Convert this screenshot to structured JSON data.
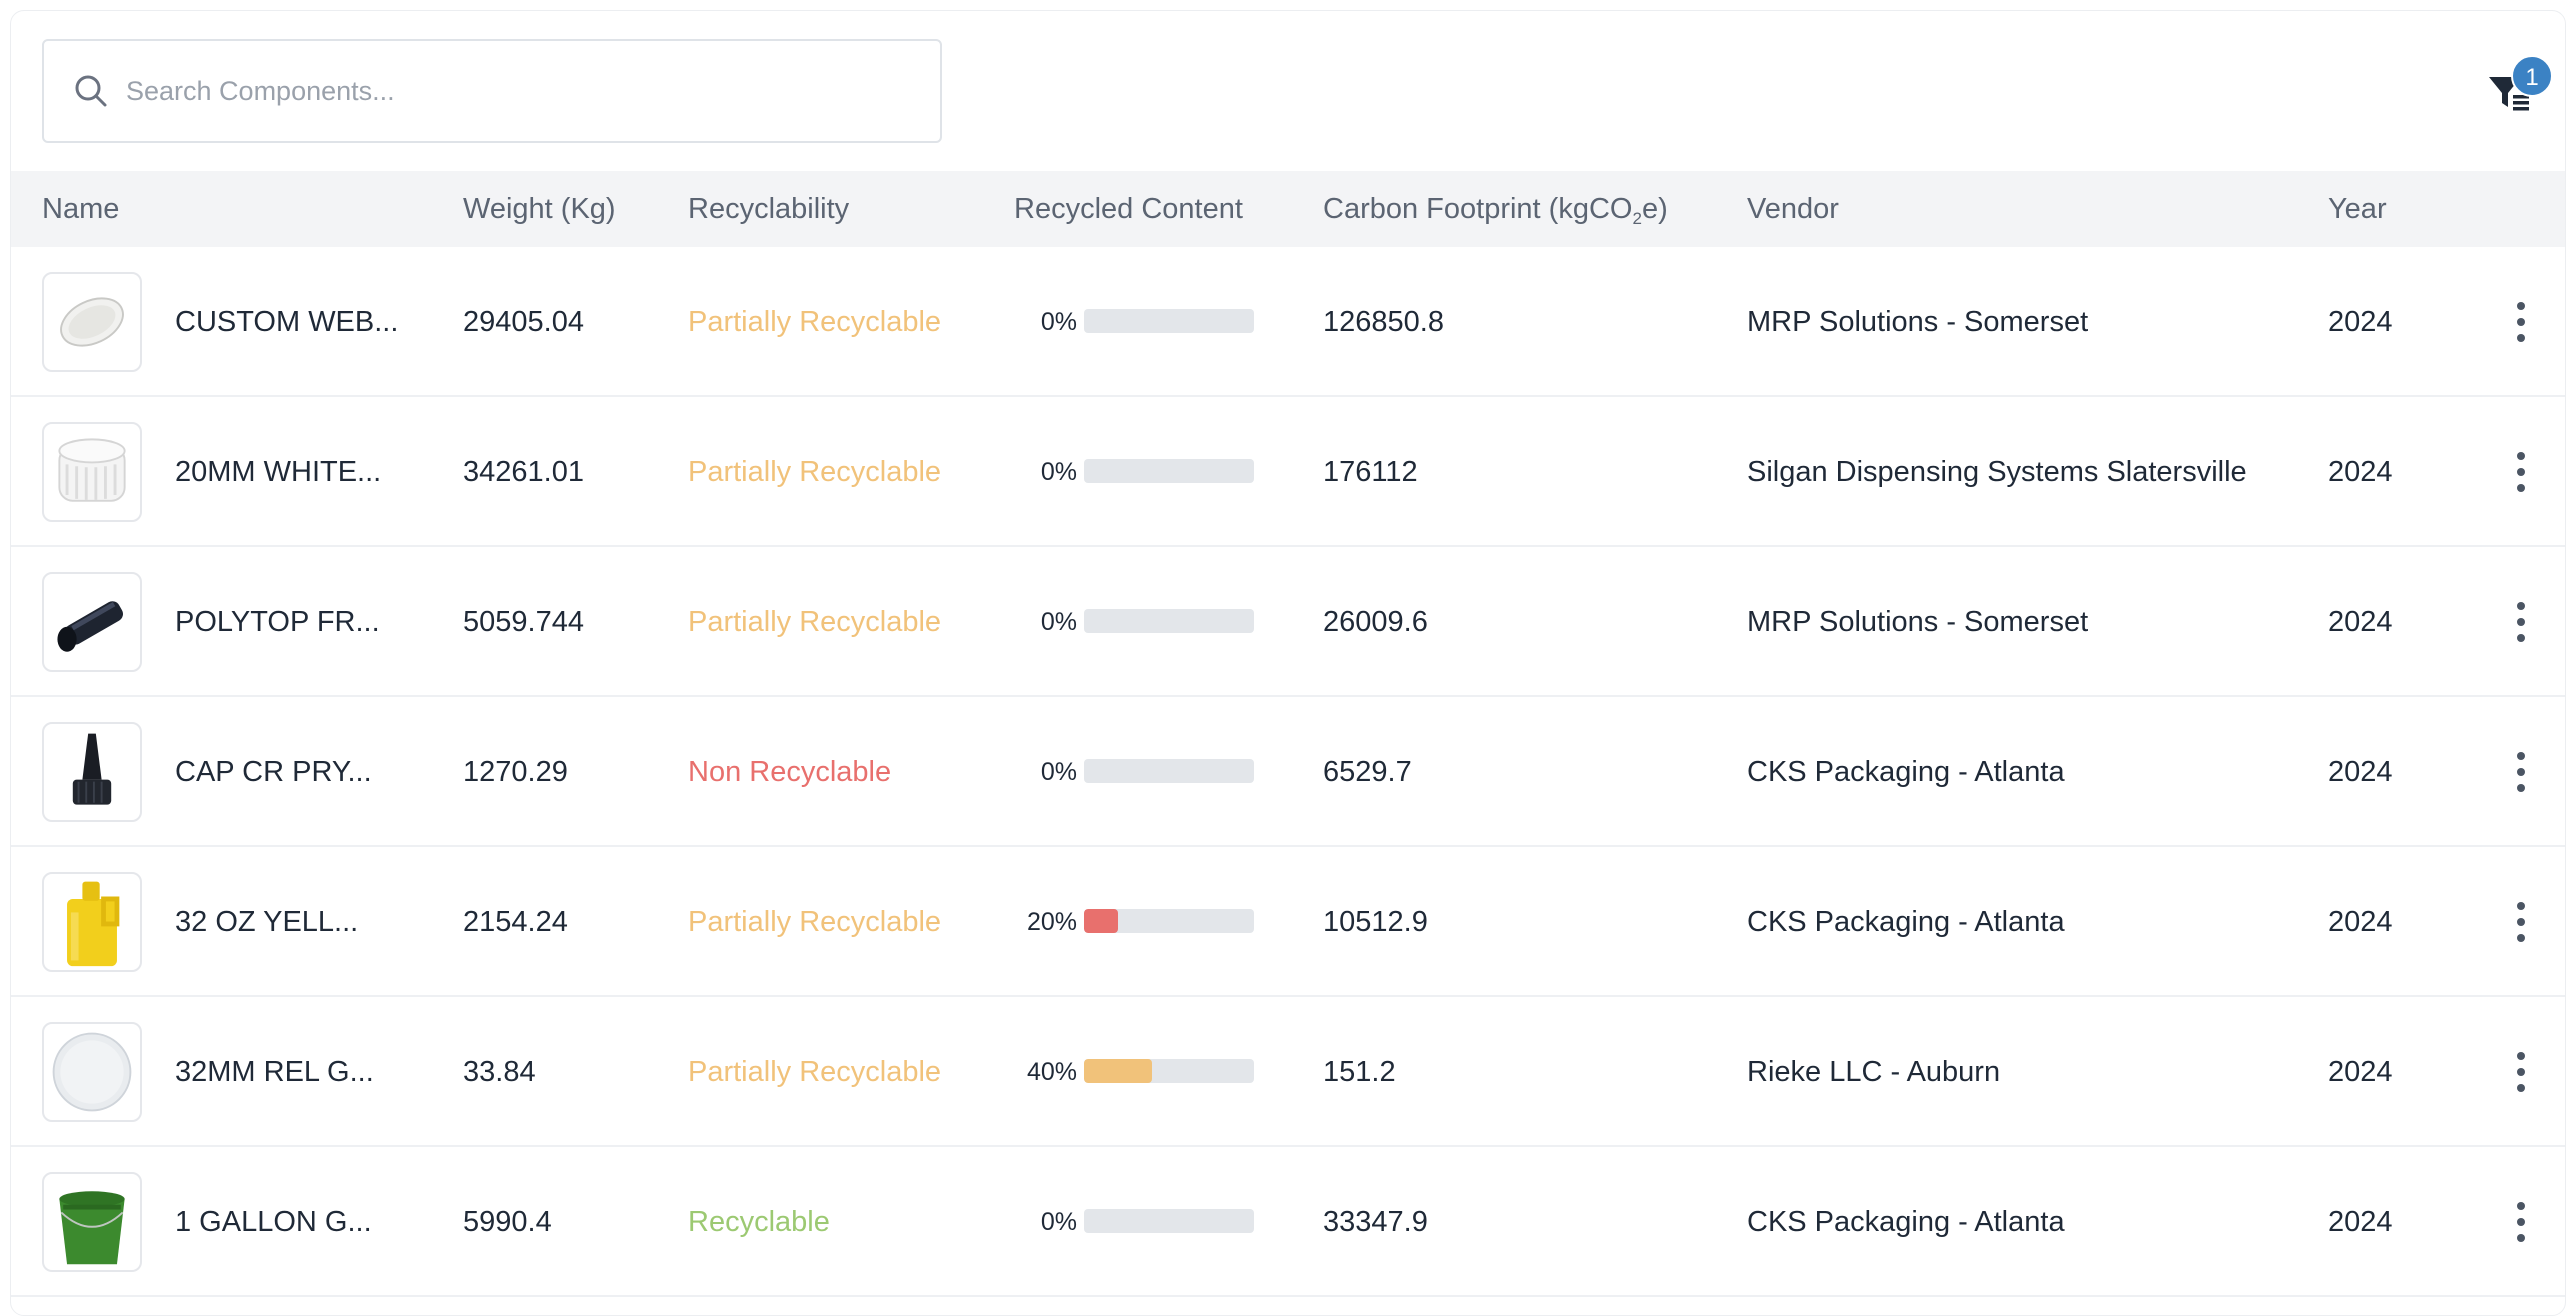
{
  "search": {
    "placeholder": "Search Components..."
  },
  "filter": {
    "badge_count": "1"
  },
  "columns": {
    "name": "Name",
    "weight": "Weight (Kg)",
    "recyclability": "Recyclability",
    "recycled_content": "Recycled Content",
    "carbon_prefix": "Carbon Footprint (kgCO",
    "carbon_sub": "2",
    "carbon_suffix": "e)",
    "vendor": "Vendor",
    "year": "Year"
  },
  "colors": {
    "partial": "#f1c27a",
    "non": "#e8706d",
    "recyclable": "#9cc972",
    "bar_track": "#e3e6ea",
    "badge": "#3b82c4"
  },
  "rows": [
    {
      "thumb_icon": "white-oval-lid-icon",
      "name": "CUSTOM WEB...",
      "weight": "29405.04",
      "recyclability": "Partially Recyclable",
      "rec_class": "partial",
      "pct_label": "0%",
      "pct": 0,
      "bar_color": "#e3e6ea",
      "carbon": "126850.8",
      "vendor": "MRP Solutions - Somerset",
      "year": "2024"
    },
    {
      "thumb_icon": "white-ribbed-cap-icon",
      "name": "20MM WHITE...",
      "weight": "34261.01",
      "recyclability": "Partially Recyclable",
      "rec_class": "partial",
      "pct_label": "0%",
      "pct": 0,
      "bar_color": "#e3e6ea",
      "carbon": "176112",
      "vendor": "Silgan Dispensing Systems Slatersville",
      "year": "2024"
    },
    {
      "thumb_icon": "black-tube-icon",
      "name": "POLYTOP FR...",
      "weight": "5059.744",
      "recyclability": "Partially Recyclable",
      "rec_class": "partial",
      "pct_label": "0%",
      "pct": 0,
      "bar_color": "#e3e6ea",
      "carbon": "26009.6",
      "vendor": "MRP Solutions - Somerset",
      "year": "2024"
    },
    {
      "thumb_icon": "black-spout-cap-icon",
      "name": "CAP CR PRY...",
      "weight": "1270.29",
      "recyclability": "Non Recyclable",
      "rec_class": "non",
      "pct_label": "0%",
      "pct": 0,
      "bar_color": "#e3e6ea",
      "carbon": "6529.7",
      "vendor": "CKS Packaging - Atlanta",
      "year": "2024"
    },
    {
      "thumb_icon": "yellow-jug-icon",
      "name": "32 OZ YELL...",
      "weight": "2154.24",
      "recyclability": "Partially Recyclable",
      "rec_class": "partial",
      "pct_label": "20%",
      "pct": 20,
      "bar_color": "#e8706d",
      "carbon": "10512.9",
      "vendor": "CKS Packaging - Atlanta",
      "year": "2024"
    },
    {
      "thumb_icon": "white-round-cap-icon",
      "name": "32MM REL G...",
      "weight": "33.84",
      "recyclability": "Partially Recyclable",
      "rec_class": "partial",
      "pct_label": "40%",
      "pct": 40,
      "bar_color": "#f1c27a",
      "carbon": "151.2",
      "vendor": "Rieke LLC - Auburn",
      "year": "2024"
    },
    {
      "thumb_icon": "green-bucket-icon",
      "name": "1 GALLON G...",
      "weight": "5990.4",
      "recyclability": "Recyclable",
      "rec_class": "yes",
      "pct_label": "0%",
      "pct": 0,
      "bar_color": "#e3e6ea",
      "carbon": "33347.9",
      "vendor": "CKS Packaging - Atlanta",
      "year": "2024"
    }
  ]
}
